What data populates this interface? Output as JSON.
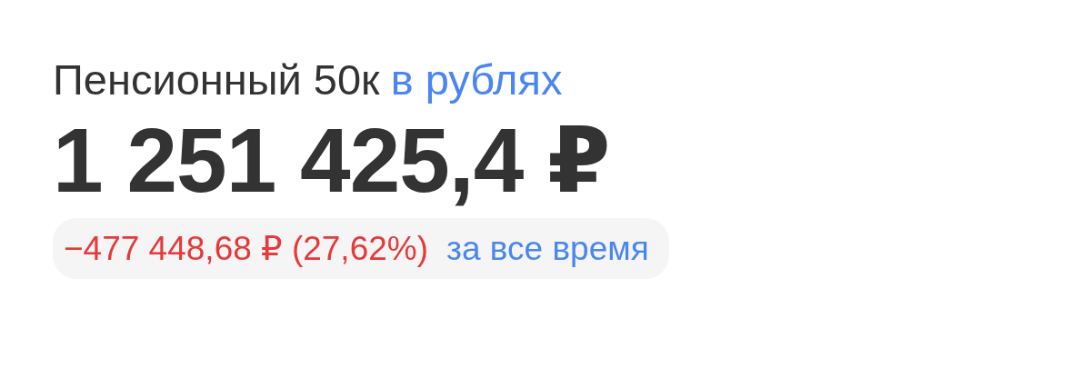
{
  "portfolio": {
    "title": "Пенсионный 50к",
    "currency_link": "в рублях"
  },
  "balance": "1 251 425,4 ₽",
  "change": {
    "value": "−477 448,68 ₽ (27,62%)",
    "negative": true,
    "period": "за все время"
  }
}
